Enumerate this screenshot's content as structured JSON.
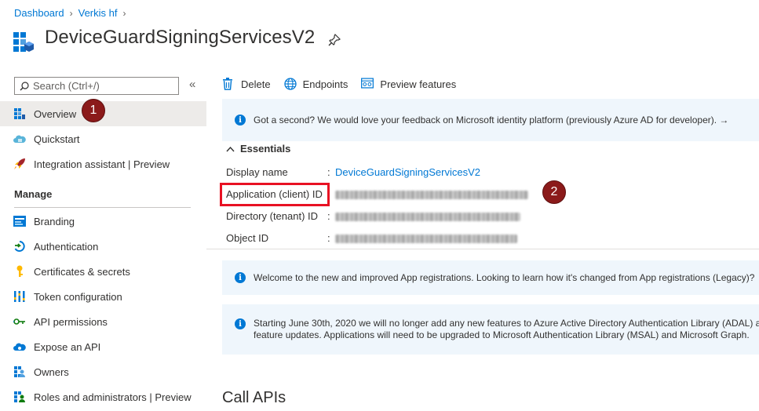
{
  "breadcrumb": {
    "items": [
      "Dashboard",
      "Verkis hf"
    ]
  },
  "header": {
    "title": "DeviceGuardSigningServicesV2"
  },
  "search": {
    "placeholder": "Search (Ctrl+/)"
  },
  "collapse_glyph": "«",
  "sidebar": {
    "top_items": [
      {
        "label": "Overview",
        "icon": "overview-grid-icon"
      },
      {
        "label": "Quickstart",
        "icon": "cloud-quickstart-icon"
      },
      {
        "label": "Integration assistant | Preview",
        "icon": "rocket-icon"
      }
    ],
    "section_title": "Manage",
    "manage_items": [
      {
        "label": "Branding",
        "icon": "branding-icon"
      },
      {
        "label": "Authentication",
        "icon": "authentication-icon"
      },
      {
        "label": "Certificates & secrets",
        "icon": "key-icon"
      },
      {
        "label": "Token configuration",
        "icon": "token-bars-icon"
      },
      {
        "label": "API permissions",
        "icon": "api-permissions-icon"
      },
      {
        "label": "Expose an API",
        "icon": "cloud-api-icon"
      },
      {
        "label": "Owners",
        "icon": "owners-icon"
      },
      {
        "label": "Roles and administrators | Preview",
        "icon": "roles-icon"
      }
    ]
  },
  "badges": {
    "one": "1",
    "two": "2"
  },
  "toolbar": {
    "delete_label": "Delete",
    "endpoints_label": "Endpoints",
    "preview_label": "Preview features"
  },
  "banners": {
    "feedback": "Got a second? We would love your feedback on Microsoft identity platform (previously Azure AD for developer). →",
    "welcome": "Welcome to the new and improved App registrations. Looking to learn how it's changed from App registrations (Legacy)?",
    "adal_line1": "Starting June 30th, 2020 we will no longer add any new features to Azure Active Directory Authentication Library (ADAL) a",
    "adal_line2": "feature updates. Applications will need to be upgraded to Microsoft Authentication Library (MSAL) and Microsoft Graph."
  },
  "essentials": {
    "heading": "Essentials",
    "rows": [
      {
        "label": "Display name",
        "value": "DeviceGuardSigningServicesV2",
        "redacted": false
      },
      {
        "label": "Application (client) ID",
        "redacted": true
      },
      {
        "label": "Directory (tenant) ID",
        "redacted": true
      },
      {
        "label": "Object ID",
        "redacted": true
      }
    ]
  },
  "call_apis": "Call APIs",
  "colors": {
    "accent": "#0078d4",
    "badge": "#8b1a1a",
    "highlight": "#e81123",
    "banner_bg": "#eff6fc"
  }
}
